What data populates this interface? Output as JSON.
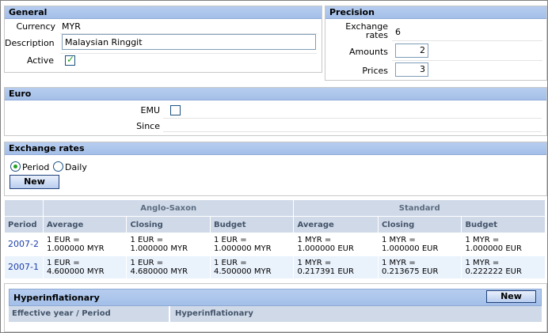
{
  "general": {
    "title": "General",
    "currency_label": "Currency",
    "currency_value": "MYR",
    "description_label": "Description",
    "description_value": "Malaysian Ringgit",
    "active_label": "Active",
    "active_checked": true
  },
  "precision": {
    "title": "Precision",
    "exchange_rates_label_line1": "Exchange",
    "exchange_rates_label_line2": "rates",
    "exchange_rates_value": "6",
    "amounts_label": "Amounts",
    "amounts_value": "2",
    "prices_label": "Prices",
    "prices_value": "3"
  },
  "euro": {
    "title": "Euro",
    "emu_label": "EMU",
    "emu_checked": false,
    "since_label": "Since"
  },
  "exchange_rates": {
    "title": "Exchange rates",
    "period_label": "Period",
    "daily_label": "Daily",
    "selected": "Period",
    "new_button": "New"
  },
  "rates_table": {
    "group_headers": [
      "Anglo-Saxon",
      "Standard"
    ],
    "columns": [
      "Period",
      "Average",
      "Closing",
      "Budget",
      "Average",
      "Closing",
      "Budget"
    ],
    "rows": [
      {
        "period": "2007-2",
        "cells": [
          [
            "1 EUR =",
            "1.000000 MYR"
          ],
          [
            "1 EUR =",
            "1.000000 MYR"
          ],
          [
            "1 EUR =",
            "1.000000 MYR"
          ],
          [
            "1 MYR =",
            "1.000000 EUR"
          ],
          [
            "1 MYR =",
            "1.000000 EUR"
          ],
          [
            "1 MYR =",
            "1.000000 EUR"
          ]
        ]
      },
      {
        "period": "2007-1",
        "cells": [
          [
            "1 EUR =",
            "4.600000 MYR"
          ],
          [
            "1 EUR =",
            "4.680000 MYR"
          ],
          [
            "1 EUR =",
            "4.500000 MYR"
          ],
          [
            "1 MYR =",
            "0.217391 EUR"
          ],
          [
            "1 MYR =",
            "0.213675 EUR"
          ],
          [
            "1 MYR =",
            "0.222222 EUR"
          ]
        ]
      }
    ]
  },
  "hyperinflationary": {
    "title": "Hyperinflationary",
    "new_button": "New",
    "columns": [
      "Effective year / Period",
      "Hyperinflationary"
    ]
  },
  "colors": {
    "header_bg": "#a3bfe8",
    "table_header_bg": "#cfd9e8",
    "link": "#1d3fa8",
    "check_green": "#21a121"
  }
}
